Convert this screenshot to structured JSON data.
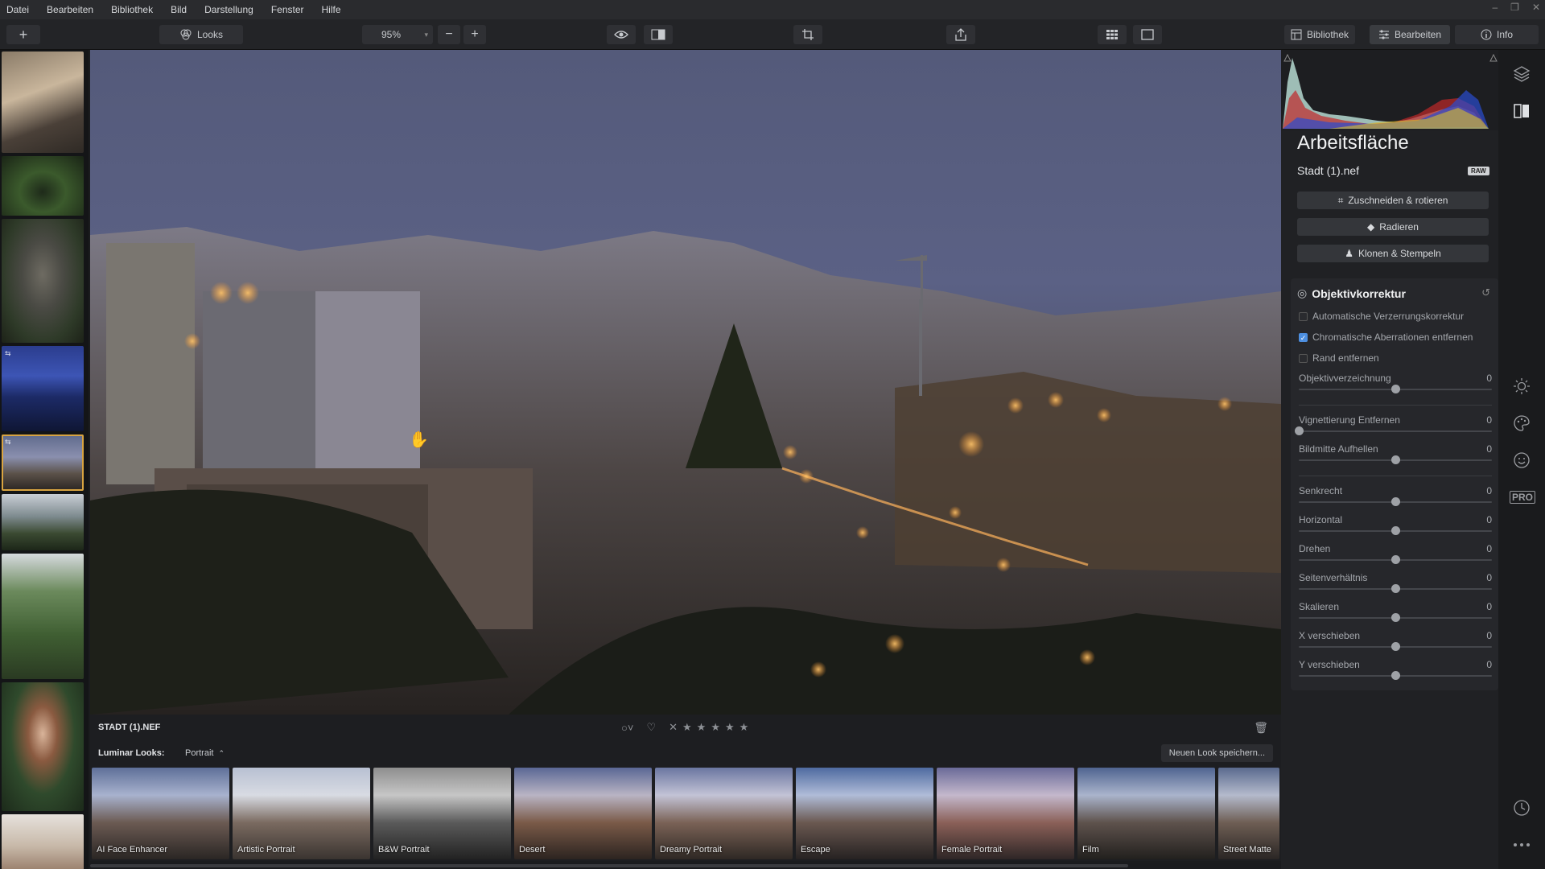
{
  "menu": [
    "Datei",
    "Bearbeiten",
    "Bibliothek",
    "Bild",
    "Darstellung",
    "Fenster",
    "Hilfe"
  ],
  "toolbar": {
    "add_label": "+",
    "looks_label": "Looks",
    "zoom_value": "95%",
    "zoom_minus": "−",
    "zoom_plus": "+",
    "tab_library": "Bibliothek",
    "tab_edit": "Bearbeiten",
    "tab_info": "Info"
  },
  "panel": {
    "title": "Arbeitsfläche",
    "filename": "Stadt (1).nef",
    "raw_badge": "RAW",
    "btn_crop": "Zuschneiden & rotieren",
    "btn_erase": "Radieren",
    "btn_clone": "Klonen & Stempeln",
    "section_title": "Objektivkorrektur",
    "checkboxes": [
      {
        "label": "Automatische Verzerrungskorrektur",
        "checked": false
      },
      {
        "label": "Chromatische Aberrationen entfernen",
        "checked": true
      },
      {
        "label": "Rand entfernen",
        "checked": false
      }
    ],
    "sliders": [
      {
        "label": "Objektivverzeichnung",
        "value": "0",
        "position": 0.5
      },
      {
        "label": "Vignettierung Entfernen",
        "value": "0",
        "position": 0.0
      },
      {
        "label": "Bildmitte Aufhellen",
        "value": "0",
        "position": 0.5
      },
      {
        "label": "Senkrecht",
        "value": "0",
        "position": 0.5
      },
      {
        "label": "Horizontal",
        "value": "0",
        "position": 0.5
      },
      {
        "label": "Drehen",
        "value": "0",
        "position": 0.5
      },
      {
        "label": "Seitenverhältnis",
        "value": "0",
        "position": 0.5
      },
      {
        "label": "Skalieren",
        "value": "0",
        "position": 0.5
      },
      {
        "label": "X verschieben",
        "value": "0",
        "position": 0.5
      },
      {
        "label": "Y verschieben",
        "value": "0",
        "position": 0.5
      }
    ]
  },
  "infobar": {
    "filename": "STADT (1).NEF"
  },
  "looksbar": {
    "label": "Luminar Looks:",
    "category": "Portrait",
    "save_label": "Neuen Look speichern..."
  },
  "looks": [
    "AI Face Enhancer",
    "Artistic Portrait",
    "B&W Portrait",
    "Desert",
    "Dreamy Portrait",
    "Escape",
    "Female Portrait",
    "Film",
    "Street Matte"
  ],
  "sidebar": {
    "pro_label": "PRO"
  },
  "colors": {
    "accent": "#d9a441",
    "checkbox_on": "#4d8fe0"
  }
}
